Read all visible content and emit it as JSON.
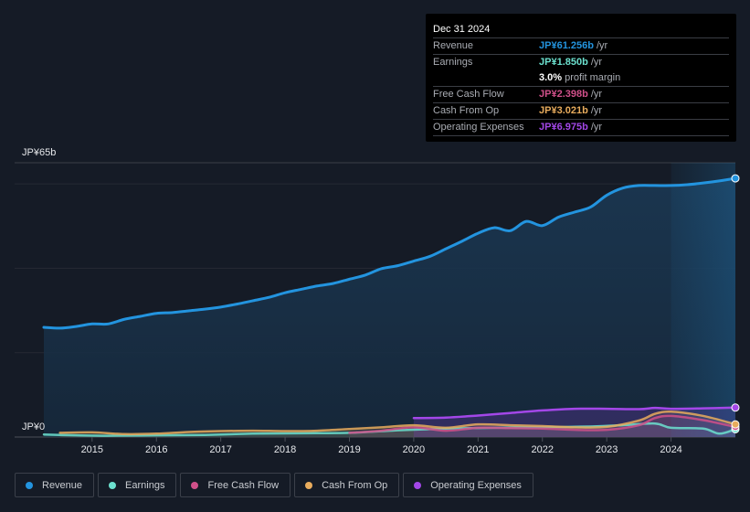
{
  "tooltip": {
    "date": "Dec 31 2024",
    "rows": [
      {
        "label": "Revenue",
        "value": "JP¥61.256b",
        "unit": "/yr",
        "color": "#2394df"
      },
      {
        "label": "Earnings",
        "value": "JP¥1.850b",
        "unit": "/yr",
        "color": "#6ce1cf"
      },
      {
        "label": "",
        "value": "3.0%",
        "unit": "profit margin",
        "color": "#ffffff"
      },
      {
        "label": "Free Cash Flow",
        "value": "JP¥2.398b",
        "unit": "/yr",
        "color": "#d0508a"
      },
      {
        "label": "Cash From Op",
        "value": "JP¥3.021b",
        "unit": "/yr",
        "color": "#e8ac5d"
      },
      {
        "label": "Operating Expenses",
        "value": "JP¥6.975b",
        "unit": "/yr",
        "color": "#a347e8"
      }
    ]
  },
  "legend": [
    {
      "label": "Revenue",
      "color": "#2394df"
    },
    {
      "label": "Earnings",
      "color": "#6ce1cf"
    },
    {
      "label": "Free Cash Flow",
      "color": "#d0508a"
    },
    {
      "label": "Cash From Op",
      "color": "#e8ac5d"
    },
    {
      "label": "Operating Expenses",
      "color": "#a347e8"
    }
  ],
  "chart_data": {
    "type": "line",
    "title": "",
    "xlabel": "",
    "ylabel": "",
    "ylim": [
      0,
      65
    ],
    "xlim": [
      2014.25,
      2025.0
    ],
    "y_tick_labels": [
      "JP¥0",
      "JP¥65b"
    ],
    "x_tick_labels": [
      "2015",
      "2016",
      "2017",
      "2018",
      "2019",
      "2020",
      "2021",
      "2022",
      "2023",
      "2024"
    ],
    "x_ticks": [
      2015,
      2016,
      2017,
      2018,
      2019,
      2020,
      2021,
      2022,
      2023,
      2024
    ],
    "gridlines": [
      0,
      20,
      40,
      60,
      65
    ],
    "highlight_from": 2024.0,
    "units": "JP¥ billions",
    "series": [
      {
        "name": "Revenue",
        "color": "#2394df",
        "x": [
          2014.25,
          2014.5,
          2014.75,
          2015.0,
          2015.25,
          2015.5,
          2015.75,
          2016.0,
          2016.25,
          2016.5,
          2016.75,
          2017.0,
          2017.25,
          2017.5,
          2017.75,
          2018.0,
          2018.25,
          2018.5,
          2018.75,
          2019.0,
          2019.25,
          2019.5,
          2019.75,
          2020.0,
          2020.25,
          2020.5,
          2020.75,
          2021.0,
          2021.25,
          2021.5,
          2021.75,
          2022.0,
          2022.25,
          2022.5,
          2022.75,
          2023.0,
          2023.25,
          2023.5,
          2023.75,
          2024.0,
          2024.25,
          2024.5,
          2024.75,
          2025.0
        ],
        "values": [
          26.0,
          25.8,
          26.2,
          26.8,
          26.8,
          27.9,
          28.6,
          29.3,
          29.5,
          29.9,
          30.3,
          30.8,
          31.5,
          32.3,
          33.1,
          34.2,
          35.0,
          35.8,
          36.4,
          37.4,
          38.4,
          39.9,
          40.6,
          41.7,
          42.8,
          44.6,
          46.4,
          48.3,
          49.6,
          48.9,
          51.1,
          50.1,
          52.1,
          53.3,
          54.5,
          57.3,
          59.0,
          59.6,
          59.6,
          59.6,
          59.8,
          60.2,
          60.7,
          61.3
        ]
      },
      {
        "name": "Earnings",
        "color": "#6ce1cf",
        "x": [
          2014.25,
          2014.75,
          2015.25,
          2016.0,
          2016.75,
          2017.5,
          2018.25,
          2019.0,
          2019.75,
          2020.5,
          2021.25,
          2022.0,
          2022.75,
          2023.25,
          2023.75,
          2024.0,
          2024.5,
          2024.75,
          2025.0
        ],
        "values": [
          0.6,
          0.4,
          0.3,
          0.4,
          0.5,
          0.8,
          0.9,
          1.0,
          1.6,
          2.0,
          2.2,
          2.3,
          2.5,
          2.8,
          3.2,
          2.2,
          2.0,
          0.8,
          1.85
        ]
      },
      {
        "name": "Free Cash Flow",
        "color": "#d0508a",
        "x": [
          2019.0,
          2019.5,
          2020.0,
          2020.5,
          2021.0,
          2021.5,
          2022.0,
          2022.5,
          2023.0,
          2023.5,
          2023.75,
          2024.0,
          2024.5,
          2025.0
        ],
        "values": [
          1.0,
          1.5,
          2.3,
          1.5,
          2.2,
          2.1,
          2.0,
          1.7,
          1.7,
          2.8,
          4.5,
          5.0,
          4.0,
          2.4
        ]
      },
      {
        "name": "Cash From Op",
        "color": "#e8ac5d",
        "x": [
          2014.5,
          2015.0,
          2015.5,
          2016.0,
          2016.5,
          2017.0,
          2017.5,
          2018.0,
          2018.5,
          2019.0,
          2019.5,
          2020.0,
          2020.5,
          2021.0,
          2021.5,
          2022.0,
          2022.5,
          2023.0,
          2023.5,
          2023.75,
          2024.0,
          2024.5,
          2025.0
        ],
        "values": [
          1.0,
          1.1,
          0.7,
          0.8,
          1.2,
          1.4,
          1.5,
          1.4,
          1.5,
          1.9,
          2.3,
          2.8,
          2.2,
          3.0,
          2.8,
          2.6,
          2.3,
          2.4,
          3.9,
          5.5,
          6.0,
          5.0,
          3.0
        ]
      },
      {
        "name": "Operating Expenses",
        "color": "#a347e8",
        "x": [
          2020.0,
          2020.5,
          2021.0,
          2021.5,
          2022.0,
          2022.5,
          2023.0,
          2023.5,
          2023.75,
          2024.0,
          2024.5,
          2025.0
        ],
        "values": [
          4.5,
          4.6,
          5.1,
          5.7,
          6.3,
          6.7,
          6.7,
          6.6,
          6.9,
          6.7,
          6.8,
          6.98
        ]
      }
    ]
  }
}
